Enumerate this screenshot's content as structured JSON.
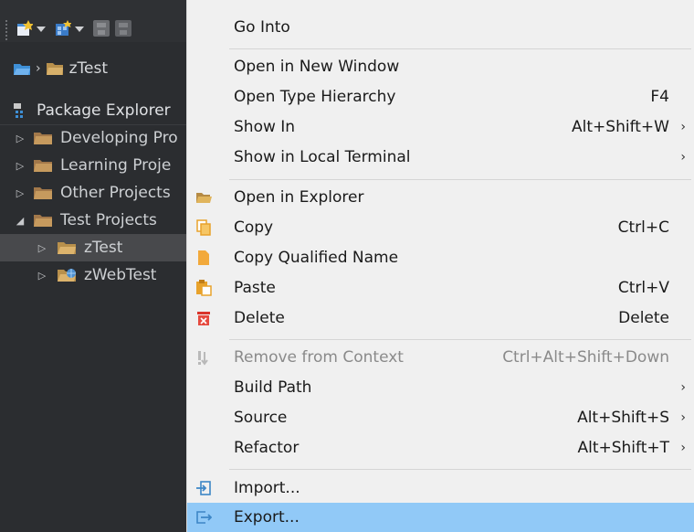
{
  "explorer": {
    "breadcrumb": {
      "separator": "›",
      "project": "zTest"
    },
    "header": {
      "title": "Package Explorer"
    },
    "tree": [
      {
        "label": "Developing Pro",
        "twisty": "▷",
        "selected": false
      },
      {
        "label": "Learning Proje",
        "twisty": "▷",
        "selected": false
      },
      {
        "label": "Other Projects",
        "twisty": "▷",
        "selected": false
      },
      {
        "label": "Test Projects",
        "twisty": "◢",
        "selected": false
      },
      {
        "label": "zTest",
        "twisty": "▷",
        "selected": true
      },
      {
        "label": "zWebTest",
        "twisty": "▷",
        "selected": false
      }
    ]
  },
  "menu": {
    "items": {
      "go_into": {
        "label": "Go Into"
      },
      "open_new_window": {
        "label": "Open in New Window"
      },
      "open_type_hierarchy": {
        "label": "Open Type Hierarchy",
        "accel": "F4"
      },
      "show_in": {
        "label": "Show In",
        "accel": "Alt+Shift+W",
        "arrow": "›"
      },
      "show_in_terminal": {
        "label": "Show in Local Terminal",
        "arrow": "›"
      },
      "open_in_explorer": {
        "label": "Open in Explorer",
        "icon": "folder-open-icon"
      },
      "copy": {
        "label": "Copy",
        "accel": "Ctrl+C",
        "icon": "copy-icon"
      },
      "copy_qualified": {
        "label": "Copy Qualified Name",
        "icon": "copy-qualified-icon"
      },
      "paste": {
        "label": "Paste",
        "accel": "Ctrl+V",
        "icon": "paste-icon"
      },
      "delete": {
        "label": "Delete",
        "accel": "Delete",
        "icon": "delete-icon"
      },
      "remove_context": {
        "label": "Remove from Context",
        "accel": "Ctrl+Alt+Shift+Down",
        "icon": "remove-context-icon"
      },
      "build_path": {
        "label": "Build Path",
        "arrow": "›"
      },
      "source": {
        "label": "Source",
        "accel": "Alt+Shift+S",
        "arrow": "›"
      },
      "refactor": {
        "label": "Refactor",
        "accel": "Alt+Shift+T",
        "arrow": "›"
      },
      "import": {
        "label": "Import...",
        "icon": "import-icon"
      },
      "export": {
        "label": "Export...",
        "icon": "export-icon"
      }
    }
  },
  "colors": {
    "dark_panel": "#2b2d30",
    "menu_bg": "#f0f0f0",
    "hover": "#91c9f7",
    "folder": "#c9a25a",
    "accent_blue": "#3d86c6"
  }
}
